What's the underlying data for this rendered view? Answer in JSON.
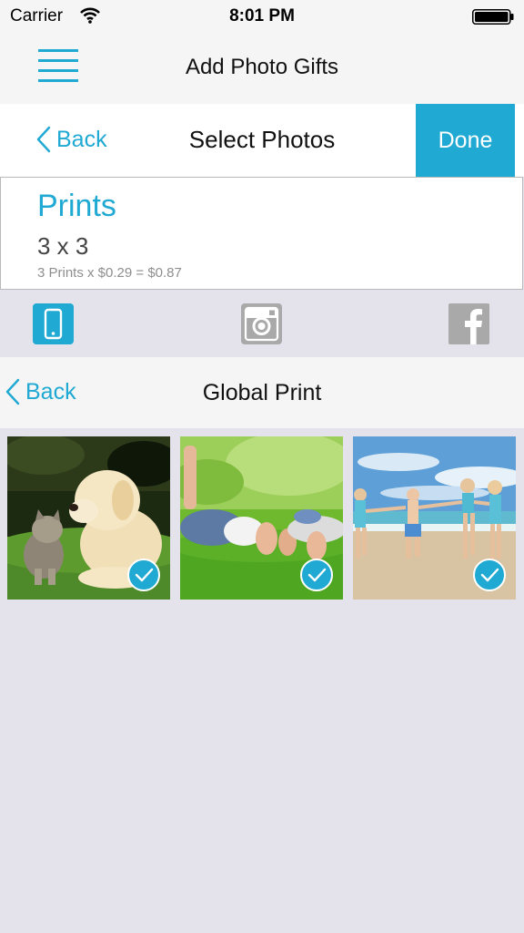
{
  "status_bar": {
    "carrier": "Carrier",
    "time": "8:01 PM"
  },
  "header": {
    "title": "Add Photo Gifts",
    "menu_icon": "menu-icon"
  },
  "select_bar": {
    "back_label": "Back",
    "title": "Select Photos",
    "done_label": "Done"
  },
  "product": {
    "name": "Prints",
    "size": "3 x 3",
    "price_line": "3 Prints x $0.29 = $0.87"
  },
  "sources": [
    {
      "icon": "phone-icon",
      "selected": true
    },
    {
      "icon": "instagram-icon",
      "selected": false
    },
    {
      "icon": "facebook-icon",
      "selected": false
    }
  ],
  "album_bar": {
    "back_label": "Back",
    "title": "Global Print"
  },
  "photos": [
    {
      "subject": "puppy and kitten on grass",
      "selected": true
    },
    {
      "subject": "kids lying on grass with feet up",
      "selected": true
    },
    {
      "subject": "children running on beach",
      "selected": true
    }
  ],
  "colors": {
    "accent": "#1fa9d3",
    "background": "#e4e3eb",
    "bar": "#f5f5f5",
    "icon_inactive": "#a9a9a9"
  }
}
